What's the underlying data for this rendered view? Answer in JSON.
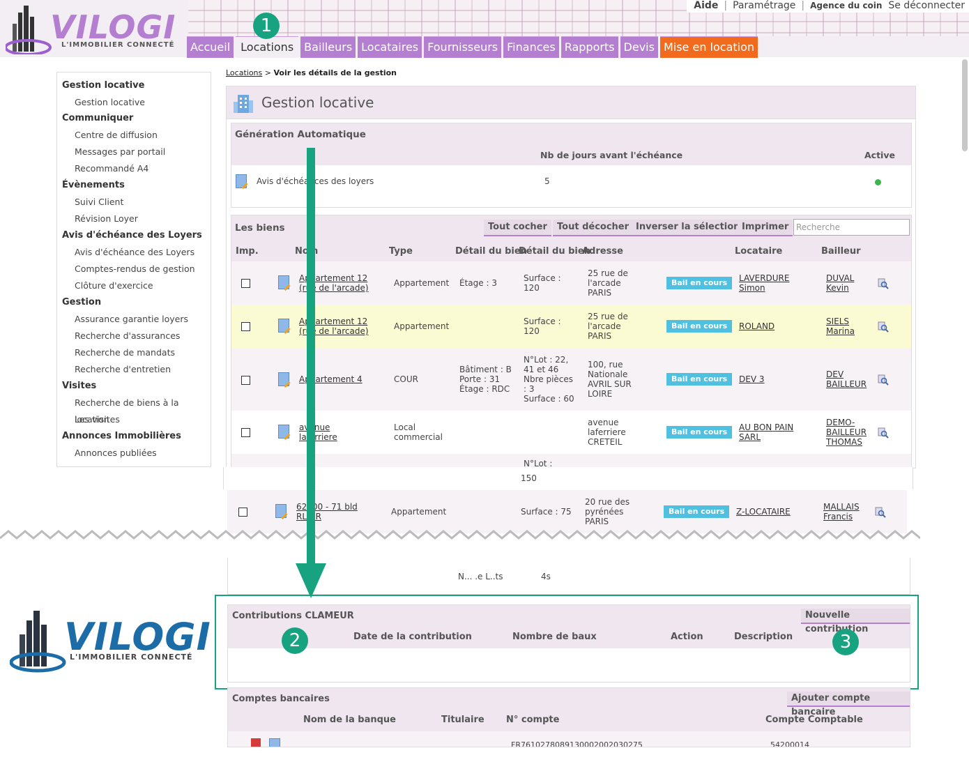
{
  "brand": {
    "name": "VILOGI",
    "tagline": "L'IMMOBILIER CONNECTÉ"
  },
  "toplinks": {
    "aide": "Aide",
    "parametrage": "Paramétrage",
    "agence": "Agence du coin",
    "deconnect": "Se déconnecter"
  },
  "tabs": [
    "Accueil",
    "Locations",
    "Bailleurs",
    "Locataires",
    "Fournisseurs",
    "Finances",
    "Rapports",
    "Devis",
    "Mise en location"
  ],
  "badges": {
    "one": "1",
    "two": "2",
    "three": "3"
  },
  "sidebar": [
    {
      "section": "Gestion locative",
      "items": [
        "Gestion locative"
      ]
    },
    {
      "section": "Communiquer",
      "items": [
        "Centre de diffusion",
        "Messages par portail",
        "Recommandé A4"
      ]
    },
    {
      "section": "Évènements",
      "items": [
        "Suivi Client",
        "Révision Loyer"
      ]
    },
    {
      "section": "Avis d'échéance des Loyers",
      "items": [
        "Avis d'échéance des Loyers",
        "Comptes-rendus de gestion",
        "Clôture d'exercice"
      ]
    },
    {
      "section": "Gestion",
      "items": [
        "Assurance garantie loyers",
        "Recherche d'assurances",
        "Recherche de mandats",
        "Recherche d'entretien"
      ]
    },
    {
      "section": "Visites",
      "items": [
        "Recherche de biens à la location",
        "Les visites"
      ]
    },
    {
      "section": "Annonces Immobilières",
      "items": [
        "Annonces publiées"
      ]
    }
  ],
  "breadcrumb": {
    "link": "Locations",
    "sep": " > ",
    "current": "Voir les détails de la gestion"
  },
  "page_title": "Gestion locative",
  "generation": {
    "title": "Génération Automatique",
    "col_days": "Nb de jours avant l'échéance",
    "col_active": "Active",
    "row_label": "Avis d'échéances des loyers",
    "row_days": "5",
    "active_color": "#3bb54a"
  },
  "biens": {
    "title": "Les biens",
    "buttons": [
      "Tout cocher",
      "Tout décocher",
      "Inverser la sélection",
      "Imprimer"
    ],
    "search_placeholder": "Recherche",
    "headers": [
      "Imp.",
      "Nom",
      "Type",
      "Détail du bien",
      "Détail du bien",
      "Adresse",
      "Locataire",
      "Bailleur"
    ],
    "status": "Bail en cours",
    "rows": [
      {
        "nom": [
          "Appartement 12",
          "(rue de l'arcade)"
        ],
        "type": [
          "Appartement"
        ],
        "detail1": [
          "Étage : 3"
        ],
        "detail2": [
          "Surface :",
          "120"
        ],
        "adresse": [
          "25 rue de",
          "l'arcade",
          "PARIS"
        ],
        "locataire": [
          "LAVERDURE",
          "Simon"
        ],
        "bailleur": [
          "DUVAL",
          "Kevin"
        ]
      },
      {
        "nom": [
          "Appartement 12",
          "(rue de l'arcade)"
        ],
        "type": [
          "Appartement"
        ],
        "detail1": [],
        "detail2": [
          "Surface :",
          "120"
        ],
        "adresse": [
          "25 rue de",
          "l'arcade",
          "PARIS"
        ],
        "locataire": [
          "ROLAND"
        ],
        "bailleur": [
          "SIELS",
          "Marina"
        ]
      },
      {
        "nom": [
          "Appartement 4"
        ],
        "type": [
          "COUR"
        ],
        "detail1": [
          "Bâtiment : B",
          "Porte : 31",
          "Étage : RDC"
        ],
        "detail2": [
          "N°Lot : 22,",
          "41 et 46",
          "Nbre pièces",
          ": 3",
          "Surface : 60"
        ],
        "adresse": [
          "100, rue",
          "Nationale",
          "AVRIL SUR",
          "LOIRE"
        ],
        "locataire": [
          "DEV 3"
        ],
        "bailleur": [
          "DEV",
          "BAILLEUR"
        ]
      },
      {
        "nom": [
          "avenue",
          "laferriere"
        ],
        "type": [
          "Local",
          "commercial"
        ],
        "detail1": [],
        "detail2": [],
        "adresse": [
          "avenue",
          "laferriere",
          "CRETEIL"
        ],
        "locataire": [
          "AU BON PAIN",
          "SARL"
        ],
        "bailleur": [
          "DEMO-",
          "BAILLEUR",
          "THOMAS"
        ]
      },
      {
        "nom": [
          "62400 - 71 bld",
          "RLOIR"
        ],
        "type": [
          "Appartement"
        ],
        "detail1": [],
        "detail2": [
          "Surface : 75"
        ],
        "adresse": [
          "20 rue des",
          "pyrénées",
          "PARIS"
        ],
        "locataire": [
          "Z-LOCATAIRE"
        ],
        "bailleur": [
          "MALLAIS",
          "Francis"
        ]
      }
    ],
    "partial": {
      "lot": "N°Lot :",
      "num": "150"
    }
  },
  "fragment": {
    "left": "N... .e L..ts",
    "right": "4s"
  },
  "contributions": {
    "title": "Contributions CLAMEUR",
    "button": "Nouvelle contribution",
    "headers": [
      "Date de la contribution",
      "Nombre de baux",
      "Action",
      "Description"
    ]
  },
  "comptes": {
    "title": "Comptes bancaires",
    "button": "Ajouter compte bancaire",
    "headers": [
      "Nom de la banque",
      "Titulaire",
      "N° compte",
      "Compte Comptable"
    ],
    "row": {
      "iban": "FR7610278089130002002030275",
      "compte": "54200014"
    }
  },
  "colors": {
    "accent": "#b57fd1",
    "orange": "#f26a1b",
    "green": "#17a37f",
    "status": "#4fc0df",
    "brandBlue": "#1c6ca8"
  }
}
